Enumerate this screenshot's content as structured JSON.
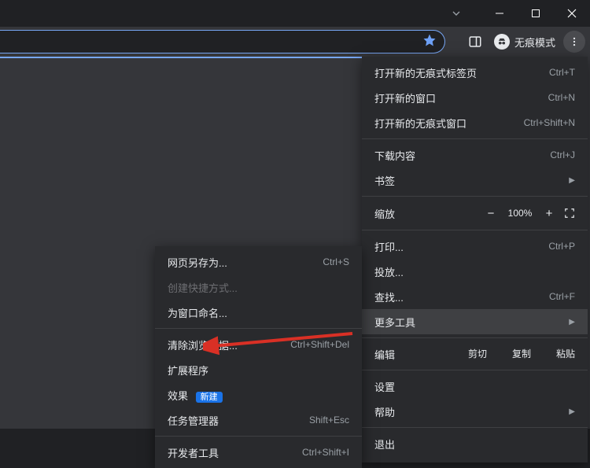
{
  "toolbar": {
    "incognito_label": "无痕模式"
  },
  "main_menu": {
    "new_incognito_tab": "打开新的无痕式标签页",
    "new_incognito_tab_sc": "Ctrl+T",
    "new_window": "打开新的窗口",
    "new_window_sc": "Ctrl+N",
    "new_incognito_window": "打开新的无痕式窗口",
    "new_incognito_window_sc": "Ctrl+Shift+N",
    "downloads": "下载内容",
    "downloads_sc": "Ctrl+J",
    "bookmarks": "书签",
    "zoom": "缩放",
    "zoom_value": "100%",
    "print": "打印...",
    "print_sc": "Ctrl+P",
    "cast": "投放...",
    "find": "查找...",
    "find_sc": "Ctrl+F",
    "more_tools": "更多工具",
    "edit": "编辑",
    "cut": "剪切",
    "copy": "复制",
    "paste": "粘贴",
    "settings": "设置",
    "help": "帮助",
    "exit": "退出"
  },
  "sub_menu": {
    "save_page": "网页另存为...",
    "save_page_sc": "Ctrl+S",
    "create_shortcut": "创建快捷方式...",
    "name_window": "为窗口命名...",
    "clear_data": "清除浏览数据...",
    "clear_data_sc": "Ctrl+Shift+Del",
    "extensions": "扩展程序",
    "performance": "效果",
    "new_badge": "新建",
    "task_manager": "任务管理器",
    "task_manager_sc": "Shift+Esc",
    "dev_tools": "开发者工具",
    "dev_tools_sc": "Ctrl+Shift+I"
  }
}
